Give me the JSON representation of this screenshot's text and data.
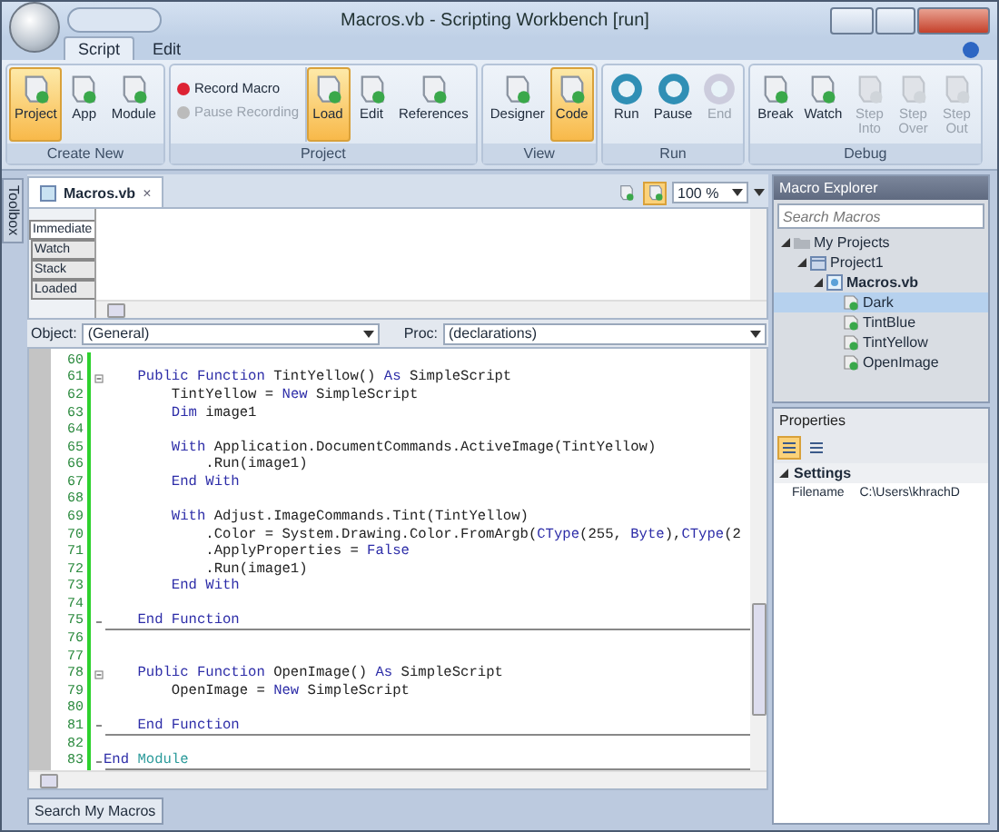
{
  "window": {
    "title": "Macros.vb - Scripting Workbench [run]"
  },
  "ribbon_tabs": [
    {
      "label": "Script",
      "selected": true
    },
    {
      "label": "Edit",
      "selected": false
    }
  ],
  "ribbon_groups": [
    {
      "label": "Create New",
      "items": [
        {
          "kind": "large",
          "label": "Project",
          "selected": true,
          "disabled": false
        },
        {
          "kind": "large",
          "label": "App",
          "selected": false,
          "disabled": false
        },
        {
          "kind": "large",
          "label": "Module",
          "selected": false,
          "disabled": false
        }
      ]
    },
    {
      "label": "Project",
      "items": [
        {
          "kind": "small",
          "label": "Record Macro",
          "selected": false,
          "disabled": false
        },
        {
          "kind": "small",
          "label": "Pause Recording",
          "selected": false,
          "disabled": true
        },
        {
          "kind": "large",
          "label": "Load",
          "selected": true,
          "disabled": false
        },
        {
          "kind": "large",
          "label": "Edit",
          "selected": false,
          "disabled": false
        },
        {
          "kind": "large",
          "label": "References",
          "selected": false,
          "disabled": false
        }
      ]
    },
    {
      "label": "View",
      "items": [
        {
          "kind": "large",
          "label": "Designer",
          "selected": false,
          "disabled": false
        },
        {
          "kind": "large",
          "label": "Code",
          "selected": true,
          "disabled": false
        }
      ]
    },
    {
      "label": "Run",
      "items": [
        {
          "kind": "round",
          "label": "Run",
          "selected": false,
          "disabled": false
        },
        {
          "kind": "round",
          "label": "Pause",
          "selected": false,
          "disabled": false
        },
        {
          "kind": "round",
          "label": "End",
          "selected": false,
          "disabled": true
        }
      ]
    },
    {
      "label": "Debug",
      "items": [
        {
          "kind": "large",
          "label": "Break",
          "selected": false,
          "disabled": false
        },
        {
          "kind": "large",
          "label": "Watch",
          "selected": false,
          "disabled": false
        },
        {
          "kind": "large",
          "label": "Step Into",
          "selected": false,
          "disabled": true
        },
        {
          "kind": "large",
          "label": "Step Over",
          "selected": false,
          "disabled": true
        },
        {
          "kind": "large",
          "label": "Step Out",
          "selected": false,
          "disabled": true
        }
      ]
    }
  ],
  "side_tab": "Toolbox",
  "document_tab": {
    "label": "Macros.vb",
    "close": "×"
  },
  "view_buttons": [
    {
      "selected": false
    },
    {
      "selected": true
    }
  ],
  "zoom": "100 %",
  "debug_tabs": [
    {
      "label": "Immediate",
      "selected": true
    },
    {
      "label": "Watch",
      "selected": false
    },
    {
      "label": "Stack",
      "selected": false
    },
    {
      "label": "Loaded",
      "selected": false
    }
  ],
  "object_combo": {
    "label": "Object:",
    "value": "(General)"
  },
  "proc_combo": {
    "label": "Proc:",
    "value": "(declarations)"
  },
  "code_lines": [
    {
      "number": "60",
      "kind": "plain"
    },
    {
      "number": "61",
      "kind": "block_start",
      "segments": [
        {
          "kind": "keyword",
          "text": "    Public Function "
        },
        {
          "kind": "plain",
          "text": "TintYellow() "
        },
        {
          "kind": "keyword",
          "text": "As "
        },
        {
          "kind": "plain",
          "text": "SimpleScript"
        }
      ]
    },
    {
      "number": "62",
      "kind": "plain",
      "segments": [
        {
          "kind": "plain",
          "text": "        TintYellow = "
        },
        {
          "kind": "keyword",
          "text": "New "
        },
        {
          "kind": "plain",
          "text": "SimpleScript"
        }
      ]
    },
    {
      "number": "63",
      "kind": "plain",
      "segments": [
        {
          "kind": "keyword",
          "text": "        Dim "
        },
        {
          "kind": "plain",
          "text": "image1"
        }
      ]
    },
    {
      "number": "64",
      "kind": "plain"
    },
    {
      "number": "65",
      "kind": "plain",
      "segments": [
        {
          "kind": "keyword",
          "text": "        With "
        },
        {
          "kind": "plain",
          "text": "Application.DocumentCommands.ActiveImage(TintYellow)"
        }
      ]
    },
    {
      "number": "66",
      "kind": "plain",
      "segments": [
        {
          "kind": "plain",
          "text": "            .Run(image1)"
        }
      ]
    },
    {
      "number": "67",
      "kind": "plain",
      "segments": [
        {
          "kind": "keyword",
          "text": "        End With"
        }
      ]
    },
    {
      "number": "68",
      "kind": "plain"
    },
    {
      "number": "69",
      "kind": "plain",
      "segments": [
        {
          "kind": "keyword",
          "text": "        With "
        },
        {
          "kind": "plain",
          "text": "Adjust.ImageCommands.Tint(TintYellow)"
        }
      ]
    },
    {
      "number": "70",
      "kind": "plain",
      "segments": [
        {
          "kind": "plain",
          "text": "            .Color = System.Drawing.Color.FromArgb("
        },
        {
          "kind": "keyword",
          "text": "CType"
        },
        {
          "kind": "plain",
          "text": "(255, "
        },
        {
          "kind": "keyword",
          "text": "Byte"
        },
        {
          "kind": "plain",
          "text": "),"
        },
        {
          "kind": "keyword",
          "text": "CType"
        },
        {
          "kind": "plain",
          "text": "(2"
        }
      ]
    },
    {
      "number": "71",
      "kind": "plain",
      "segments": [
        {
          "kind": "plain",
          "text": "            .ApplyProperties = "
        },
        {
          "kind": "keyword",
          "text": "False"
        }
      ]
    },
    {
      "number": "72",
      "kind": "plain",
      "segments": [
        {
          "kind": "plain",
          "text": "            .Run(image1)"
        }
      ]
    },
    {
      "number": "73",
      "kind": "plain",
      "segments": [
        {
          "kind": "keyword",
          "text": "        End With"
        }
      ]
    },
    {
      "number": "74",
      "kind": "plain"
    },
    {
      "number": "75",
      "kind": "block_end",
      "segments": [
        {
          "kind": "keyword",
          "text": "    End Function"
        }
      ]
    },
    {
      "number": "76",
      "kind": "plain"
    },
    {
      "number": "77",
      "kind": "plain"
    },
    {
      "number": "78",
      "kind": "block_start",
      "segments": [
        {
          "kind": "keyword",
          "text": "    Public Function "
        },
        {
          "kind": "plain",
          "text": "OpenImage() "
        },
        {
          "kind": "keyword",
          "text": "As "
        },
        {
          "kind": "plain",
          "text": "SimpleScript"
        }
      ]
    },
    {
      "number": "79",
      "kind": "plain",
      "segments": [
        {
          "kind": "plain",
          "text": "        OpenImage = "
        },
        {
          "kind": "keyword",
          "text": "New "
        },
        {
          "kind": "plain",
          "text": "SimpleScript"
        }
      ]
    },
    {
      "number": "80",
      "kind": "plain"
    },
    {
      "number": "81",
      "kind": "block_end",
      "segments": [
        {
          "kind": "keyword",
          "text": "    End Function"
        }
      ]
    },
    {
      "number": "82",
      "kind": "plain"
    },
    {
      "number": "83",
      "kind": "block_end",
      "segments": [
        {
          "kind": "keyword",
          "text": "End "
        },
        {
          "kind": "type",
          "text": "Module"
        }
      ]
    }
  ],
  "bottom_tab": "Search My Macros",
  "macro_explorer": {
    "title": "Macro Explorer",
    "search_placeholder": "Search Macros",
    "tree": [
      {
        "label": "My Projects",
        "kind": "folder",
        "expanded": true,
        "selected": false,
        "children": [
          {
            "label": "Project1",
            "kind": "project",
            "expanded": true,
            "selected": false,
            "children": [
              {
                "label": "Macros.vb",
                "kind": "file",
                "expanded": true,
                "selected": false,
                "children": [
                  {
                    "label": "Dark",
                    "kind": "macro",
                    "selected": true
                  },
                  {
                    "label": "TintBlue",
                    "kind": "macro",
                    "selected": false
                  },
                  {
                    "label": "TintYellow",
                    "kind": "macro",
                    "selected": false
                  },
                  {
                    "label": "OpenImage",
                    "kind": "macro",
                    "selected": false
                  }
                ]
              }
            ]
          }
        ]
      }
    ]
  },
  "properties": {
    "title": "Properties",
    "sort_buttons": [
      {
        "selected": true
      },
      {
        "selected": false
      }
    ],
    "category": {
      "label": "Settings",
      "expanded": true
    },
    "rows": [
      {
        "name": "Filename",
        "value": "C:\\Users\\khrachD"
      }
    ]
  }
}
